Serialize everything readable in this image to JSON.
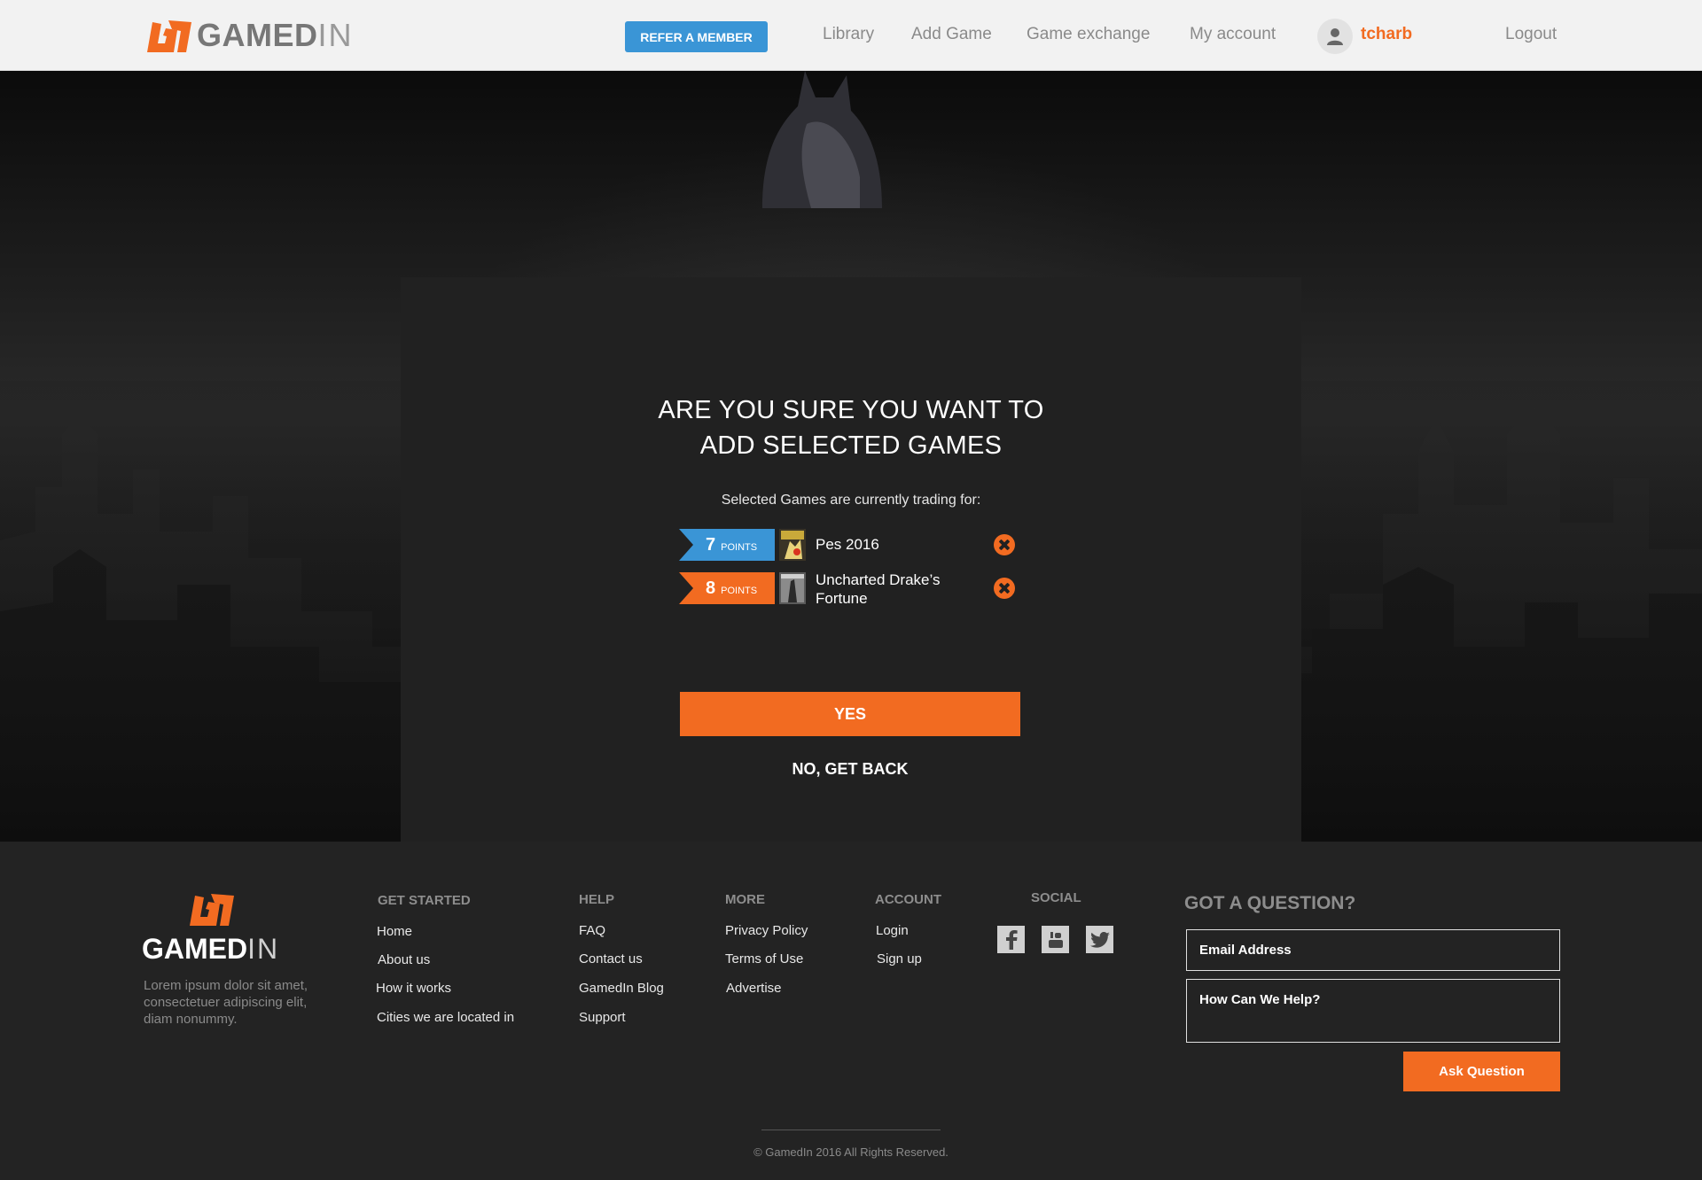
{
  "header": {
    "logo_text": "GAMED",
    "logo_text_in": "IN",
    "refer_button": "REFER A MEMBER",
    "nav": [
      "Library",
      "Add Game",
      "Game exchange",
      "My account"
    ],
    "username": "tcharb",
    "logout": "Logout"
  },
  "modal": {
    "title_line1": "ARE YOU SURE YOU WANT TO",
    "title_line2": "ADD SELECTED GAMES",
    "subtitle": "Selected Games are currently trading for:",
    "games": [
      {
        "points": "7",
        "points_unit": "POINTS",
        "name": "Pes 2016",
        "ribbon_color": "#3a95d6"
      },
      {
        "points": "8",
        "points_unit": "POINTS",
        "name": "Uncharted Drake’s Fortune",
        "ribbon_color": "#f26b21"
      }
    ],
    "yes_button": "YES",
    "no_button": "NO, GET BACK"
  },
  "footer": {
    "logo_text": "GAMED",
    "logo_text_in": "IN",
    "description": "Lorem ipsum dolor sit amet, consectetuer adipiscing elit, diam nonummy.",
    "columns": {
      "get_started": {
        "title": "GET STARTED",
        "links": [
          "Home",
          "About us",
          "How it works",
          "Cities we are located in"
        ]
      },
      "help": {
        "title": "HELP",
        "links": [
          "FAQ",
          "Contact us",
          "GamedIn Blog",
          "Support"
        ]
      },
      "more": {
        "title": "MORE",
        "links": [
          "Privacy Policy",
          "Terms of Use",
          "Advertise"
        ]
      },
      "account": {
        "title": "ACCOUNT",
        "links": [
          "Login",
          "Sign up"
        ]
      },
      "social": {
        "title": "SOCIAL",
        "icons": [
          "facebook-icon",
          "youtube-icon",
          "twitter-icon"
        ]
      }
    },
    "question": {
      "title": "GOT A QUESTION?",
      "email_placeholder": "Email Address",
      "message_placeholder": "How Can We Help?",
      "ask_button": "Ask Question"
    },
    "copyright": "© GamedIn 2016 All Rights Reserved."
  },
  "colors": {
    "accent_orange": "#f26b21",
    "accent_blue": "#3a95d6",
    "dark_bg": "#232323",
    "modal_bg": "#212121"
  }
}
